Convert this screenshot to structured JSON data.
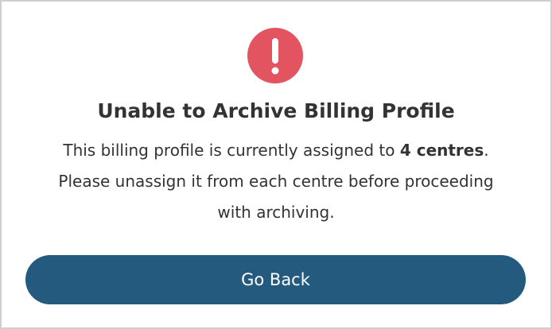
{
  "dialog": {
    "icon": "exclamation-circle-icon",
    "icon_color": "#e2545f",
    "title": "Unable to Archive Billing Profile",
    "message": {
      "line1_prefix": "This billing profile is currently assigned to ",
      "line1_bold": "4 centres",
      "line1_suffix": ".",
      "line2": "Please unassign it from each centre before proceeding",
      "line3": "with archiving."
    },
    "button_label": "Go Back",
    "button_color": "#245a7d"
  }
}
